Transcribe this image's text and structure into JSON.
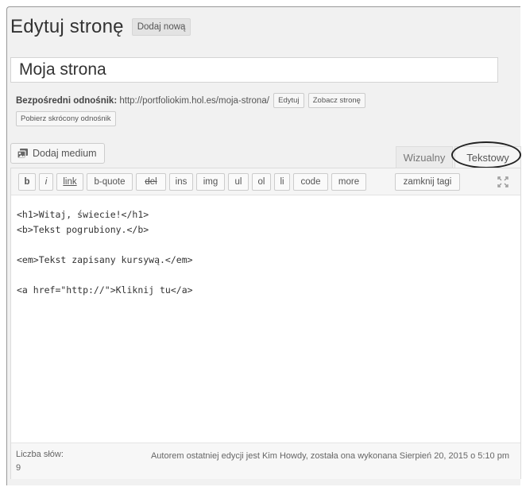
{
  "header": {
    "title": "Edytuj stronę",
    "add_new_label": "Dodaj nową"
  },
  "title_field": {
    "value": "Moja strona"
  },
  "permalink": {
    "label": "Bezpośredni odnośnik:",
    "url": "http://portfoliokim.hol.es/moja-strona/",
    "edit_label": "Edytuj",
    "view_label": "Zobacz stronę",
    "shortlink_label": "Pobierz skrócony odnośnik"
  },
  "media": {
    "add_media_label": "Dodaj medium"
  },
  "tabs": {
    "visual": "Wizualny",
    "text": "Tekstowy"
  },
  "toolbar": {
    "buttons": [
      "b",
      "i",
      "link",
      "b-quote",
      "del",
      "ins",
      "img",
      "ul",
      "ol",
      "li",
      "code",
      "more",
      "zamknij tagi"
    ]
  },
  "editor": {
    "content": "<h1>Witaj, świecie!</h1>\n<b>Tekst pogrubiony.</b>\n\n<em>Tekst zapisany kursywą.</em>\n\n<a href=\"http://\">Kliknij tu</a>"
  },
  "status": {
    "word_count_label": "Liczba słów:",
    "word_count": "9",
    "last_edit": "Autorem ostatniej edycji jest Kim Howdy, została ona wykonana Sierpień 20, 2015 o 5:10 pm"
  }
}
